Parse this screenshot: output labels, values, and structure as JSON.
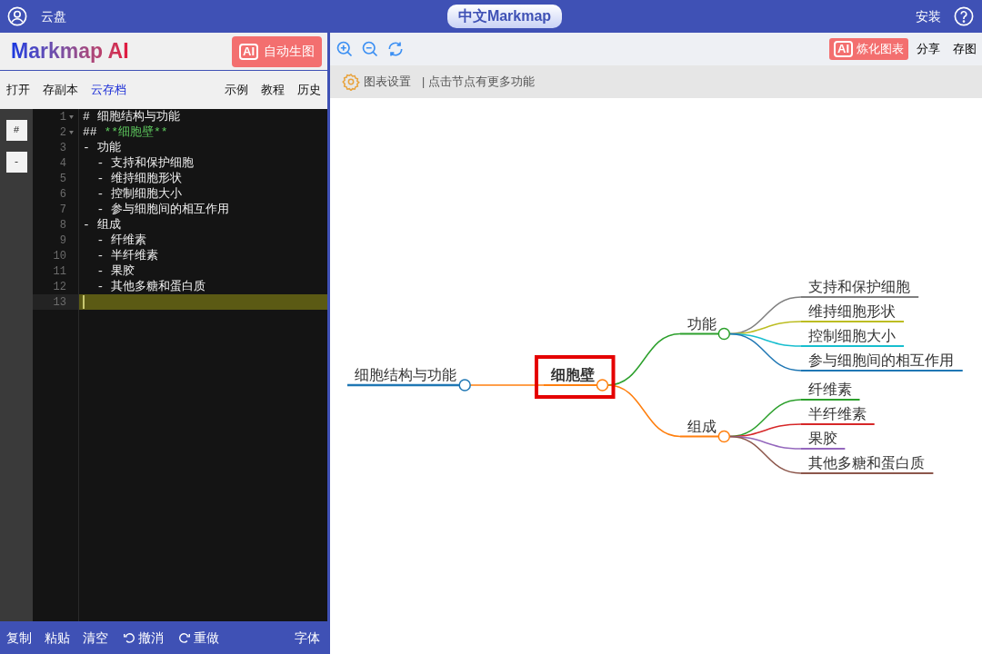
{
  "header": {
    "account_label": "云盘",
    "title": "中文Markmap",
    "install": "安装"
  },
  "editor_panel": {
    "logo": "Markmap AI",
    "auto_button": {
      "badge": "AI",
      "label": "自动生图"
    },
    "menu_left": [
      {
        "label": "打开",
        "selected": false
      },
      {
        "label": "存副本",
        "selected": false
      },
      {
        "label": "云存档",
        "selected": true
      }
    ],
    "menu_right": [
      "示例",
      "教程",
      "历史"
    ],
    "side_buttons": [
      "#",
      "-"
    ],
    "lines": [
      {
        "number": "1",
        "text": "# 细胞结构与功能",
        "foldable": true,
        "current": false
      },
      {
        "number": "2",
        "text": "## ",
        "strong": "**细胞壁**",
        "foldable": true,
        "current": false
      },
      {
        "number": "3",
        "text": "- 功能",
        "foldable": false,
        "current": false
      },
      {
        "number": "4",
        "text": "  - 支持和保护细胞",
        "foldable": false,
        "current": false
      },
      {
        "number": "5",
        "text": "  - 维持细胞形状",
        "foldable": false,
        "current": false
      },
      {
        "number": "6",
        "text": "  - 控制细胞大小",
        "foldable": false,
        "current": false
      },
      {
        "number": "7",
        "text": "  - 参与细胞间的相互作用",
        "foldable": false,
        "current": false
      },
      {
        "number": "8",
        "text": "- 组成",
        "foldable": false,
        "current": false
      },
      {
        "number": "9",
        "text": "  - 纤维素",
        "foldable": false,
        "current": false
      },
      {
        "number": "10",
        "text": "  - 半纤维素",
        "foldable": false,
        "current": false
      },
      {
        "number": "11",
        "text": "  - 果胶",
        "foldable": false,
        "current": false
      },
      {
        "number": "12",
        "text": "  - 其他多糖和蛋白质",
        "foldable": false,
        "current": false
      },
      {
        "number": "13",
        "foldable": false,
        "current": true
      }
    ],
    "footer": [
      {
        "label": "复制",
        "kind": "plain"
      },
      {
        "label": "粘贴",
        "kind": "plain"
      },
      {
        "label": "清空",
        "kind": "plain"
      },
      {
        "label": "撤消",
        "kind": "undo"
      },
      {
        "label": "重做",
        "kind": "redo"
      }
    ],
    "font_button": "字体"
  },
  "toolbar": {
    "ai_button": {
      "badge": "AI",
      "label": "炼化图表"
    },
    "share": "分享",
    "save_image": "存图"
  },
  "settings_bar": {
    "settings": "图表设置",
    "hint": "| 点击节点有更多功能"
  },
  "mindmap": {
    "root": {
      "label": "细胞结构与功能",
      "color": "#1f77b4",
      "selected": false,
      "children": [
        {
          "label": "细胞壁",
          "color": "#ff7f0e",
          "selected": true,
          "children": [
            {
              "label": "功能",
              "color": "#2ca02c",
              "selected": false,
              "children": [
                {
                  "label": "支持和保护细胞",
                  "color": "#7f7f7f",
                  "selected": false
                },
                {
                  "label": "维持细胞形状",
                  "color": "#bcbd22",
                  "selected": false
                },
                {
                  "label": "控制细胞大小",
                  "color": "#17becf",
                  "selected": false
                },
                {
                  "label": "参与细胞间的相互作用",
                  "color": "#1f77b4",
                  "selected": false
                }
              ]
            },
            {
              "label": "组成",
              "color": "#ff7f0e",
              "selected": false,
              "children": [
                {
                  "label": "纤维素",
                  "color": "#2ca02c",
                  "selected": false
                },
                {
                  "label": "半纤维素",
                  "color": "#d62728",
                  "selected": false
                },
                {
                  "label": "果胶",
                  "color": "#9467bd",
                  "selected": false
                },
                {
                  "label": "其他多糖和蛋白质",
                  "color": "#8c564b",
                  "selected": false
                }
              ]
            }
          ]
        }
      ]
    }
  }
}
